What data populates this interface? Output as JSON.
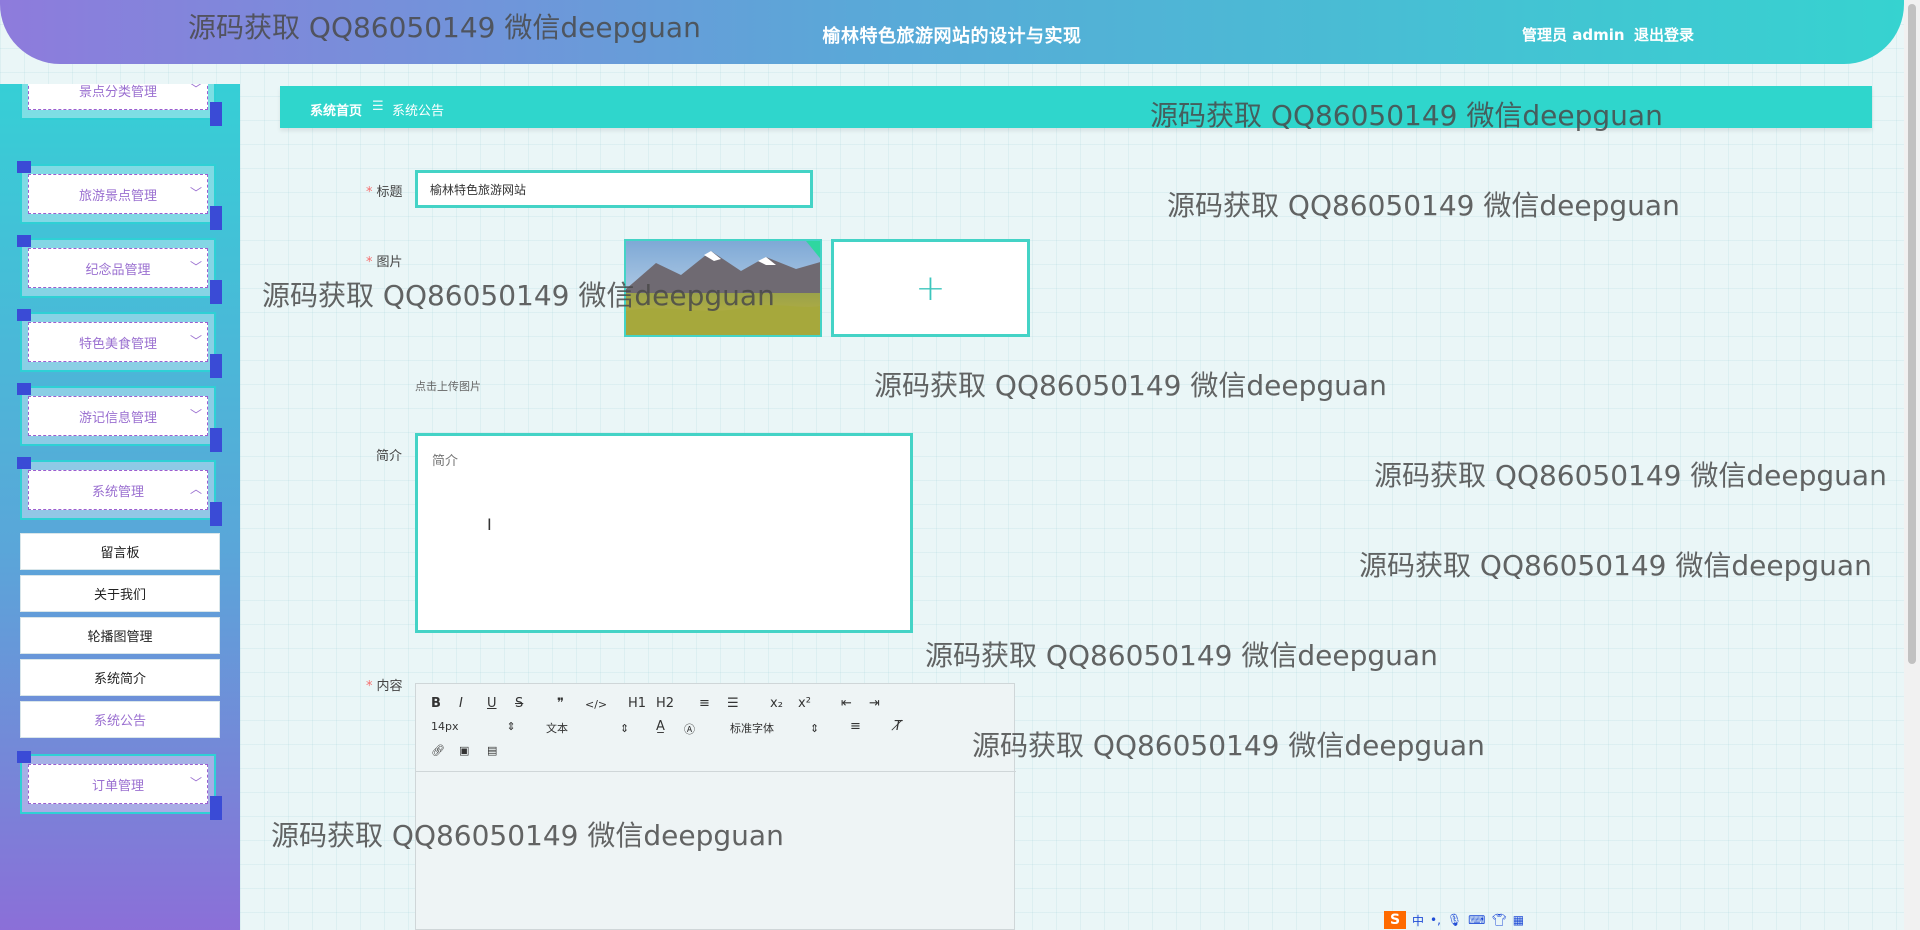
{
  "header": {
    "title": "榆林特色旅游网站的设计与实现",
    "user": "管理员 admin",
    "logout": "退出登录"
  },
  "sidebar": {
    "groups": [
      {
        "label": "景点分类管理"
      },
      {
        "label": "旅游景点管理"
      },
      {
        "label": "纪念品管理"
      },
      {
        "label": "特色美食管理"
      },
      {
        "label": "游记信息管理"
      },
      {
        "label": "系统管理"
      },
      {
        "label": "订单管理"
      }
    ],
    "sub_items": [
      {
        "label": "留言板"
      },
      {
        "label": "关于我们"
      },
      {
        "label": "轮播图管理"
      },
      {
        "label": "系统简介"
      },
      {
        "label": "系统公告"
      }
    ]
  },
  "breadcrumb": {
    "home": "系统首页",
    "separator": "☰",
    "current": "系统公告"
  },
  "form": {
    "title_label": "标题",
    "title_value": "榆林特色旅游网站",
    "picture_label": "图片",
    "upload_tip": "点击上传图片",
    "brief_label": "简介",
    "brief_placeholder": "简介",
    "content_label": "内容"
  },
  "editor": {
    "font_size": "14px",
    "text_style": "文本",
    "font_family": "标准字体",
    "buttons": [
      "B",
      "I",
      "U",
      "S",
      "❞",
      "</>",
      "H1",
      "H2",
      "≡",
      "☰",
      "x₂",
      "x²",
      "⇤",
      "⇥"
    ]
  },
  "watermark": "源码获取 QQ86050149 微信deepguan",
  "ime": {
    "label": "中"
  }
}
